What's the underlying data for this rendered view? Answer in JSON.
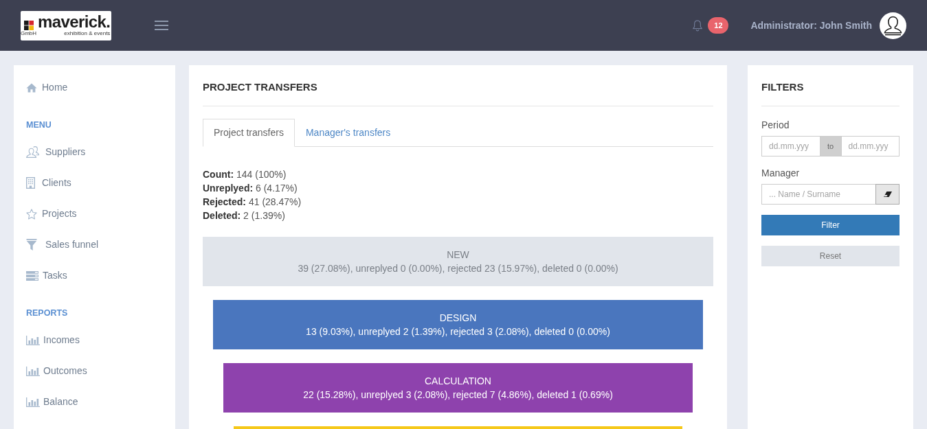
{
  "header": {
    "logo": {
      "wordmark": "maverick.",
      "legal_form": "GmbH",
      "tagline": "exhibition & events"
    },
    "notifications": {
      "count": "12"
    },
    "user": {
      "label": "Administrator: John Smith"
    }
  },
  "sidebar": {
    "items": [
      {
        "kind": "home",
        "label": "Home"
      }
    ],
    "sections": [
      {
        "title": "MENU",
        "items": [
          {
            "kind": "users",
            "label": "Suppliers"
          },
          {
            "kind": "building",
            "label": "Clients"
          },
          {
            "kind": "star",
            "label": "Projects"
          },
          {
            "kind": "funnel",
            "label": "Sales funnel"
          },
          {
            "kind": "list",
            "label": "Tasks"
          }
        ]
      },
      {
        "title": "REPORTS",
        "items": [
          {
            "kind": "chart",
            "label": "Incomes"
          },
          {
            "kind": "chart",
            "label": "Outcomes"
          },
          {
            "kind": "chart",
            "label": "Balance"
          }
        ]
      }
    ]
  },
  "main": {
    "title": "PROJECT TRANSFERS",
    "tabs": [
      {
        "label": "Project transfers",
        "selected": true
      },
      {
        "label": "Manager's transfers",
        "selected": false
      }
    ],
    "stats": [
      "**Count:** 144 (100%)",
      "**Unreplyed:** 6 (4.17%)",
      "**Rejected:** 41 (28.47%)",
      "**Deleted:** 2 (1.39%)"
    ],
    "stages": [
      {
        "title": "NEW",
        "summary": "39 (27.08%), unreplyed 0 (0.00%), rejected 23 (15.97%), deleted 0 (0.00%)",
        "color": "#e1e5eb"
      },
      {
        "title": "DESIGN",
        "summary": "13 (9.03%), unreplyed 2 (1.39%), rejected 3 (2.08%), deleted 0 (0.00%)",
        "color": "#4a76be"
      },
      {
        "title": "CALCULATION",
        "summary": "22 (15.28%), unreplyed 3 (2.08%), rejected 7 (4.86%), deleted 1 (0.69%)",
        "color": "#8e42ad"
      },
      {
        "color": "#f5c81a"
      }
    ]
  },
  "filters": {
    "title": "FILTERS",
    "period": {
      "label": "Period",
      "from": {
        "placeholder": "dd.mm.yyy"
      },
      "separator": "to",
      "to": {
        "placeholder": "dd.mm.yyy"
      }
    },
    "manager": {
      "label": "Manager",
      "placeholder": "... Name / Surname"
    },
    "buttons": [
      {
        "kind": "primary",
        "label": "Filter"
      },
      {
        "kind": "secondary",
        "label": "Reset"
      }
    ]
  }
}
